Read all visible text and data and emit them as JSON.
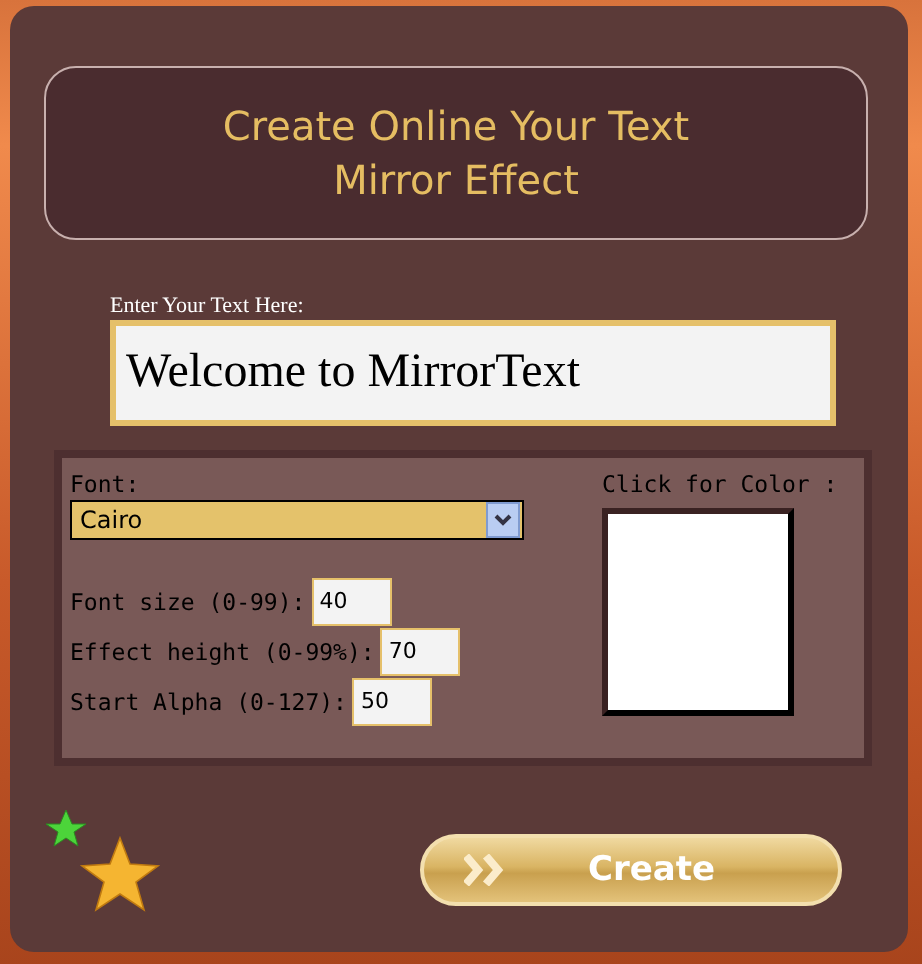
{
  "header": {
    "title": "Create Online Your Text\nMirror Effect"
  },
  "text_input": {
    "label": "Enter Your Text Here:",
    "value": "Welcome to MirrorText"
  },
  "options": {
    "font": {
      "label": "Font:",
      "value": "Cairo"
    },
    "fields": [
      {
        "label": "Font size (0-99):",
        "value": "40"
      },
      {
        "label": "Effect height (0-99%):",
        "value": "70"
      },
      {
        "label": "Start Alpha (0-127):",
        "value": "50"
      }
    ],
    "color": {
      "label": "Click for Color :",
      "color": "#ffffff"
    }
  },
  "create_button": {
    "label": "Create"
  }
}
